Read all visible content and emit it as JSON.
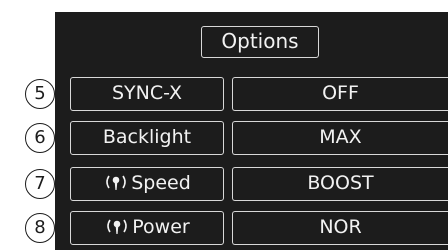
{
  "title": "Options",
  "rows": [
    {
      "number": "5",
      "label": "SYNC-X",
      "value": "OFF",
      "wireless": false
    },
    {
      "number": "6",
      "label": "Backlight",
      "value": "MAX",
      "wireless": false
    },
    {
      "number": "7",
      "label": "Speed",
      "value": "BOOST",
      "wireless": true
    },
    {
      "number": "8",
      "label": "Power",
      "value": "NOR",
      "wireless": true
    }
  ],
  "icons": {
    "wireless": "wireless-signal-icon"
  },
  "colors": {
    "panel": "#1c1c1c",
    "text": "#f2f2f2",
    "border": "#d8d8d8",
    "badge_bg": "#ffffff"
  }
}
